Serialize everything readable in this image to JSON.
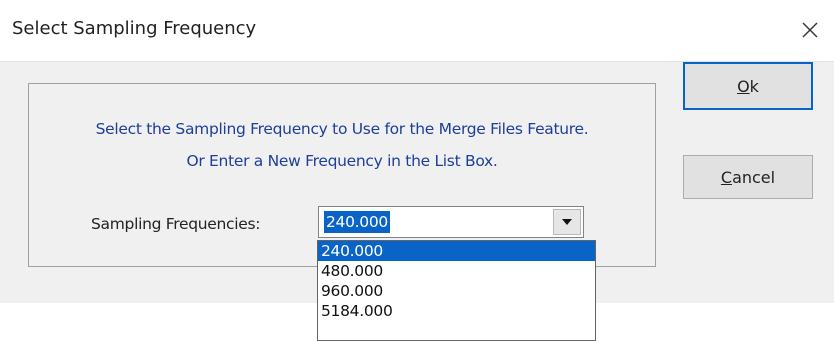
{
  "window": {
    "title": "Select Sampling Frequency",
    "close_icon": "close-icon"
  },
  "content": {
    "instruction_line1": "Select the Sampling Frequency to Use for the Merge Files Feature.",
    "instruction_line2": "Or Enter a New Frequency in the List Box.",
    "frequency_label": "Sampling Frequencies:",
    "combo_value": "240.000",
    "combo_arrow_icon": "chevron-down-icon"
  },
  "buttons": {
    "ok_mnemonic": "O",
    "ok_rest": "k",
    "cancel_mnemonic": "C",
    "cancel_rest": "ancel"
  },
  "dropdown": {
    "items": [
      "240.000",
      "480.000",
      "960.000",
      "5184.000"
    ],
    "selected_index": 0
  },
  "colors": {
    "selection": "#0a64c8",
    "instruction_text": "#1c3f9a",
    "dialog_background": "#f0f0f0"
  }
}
